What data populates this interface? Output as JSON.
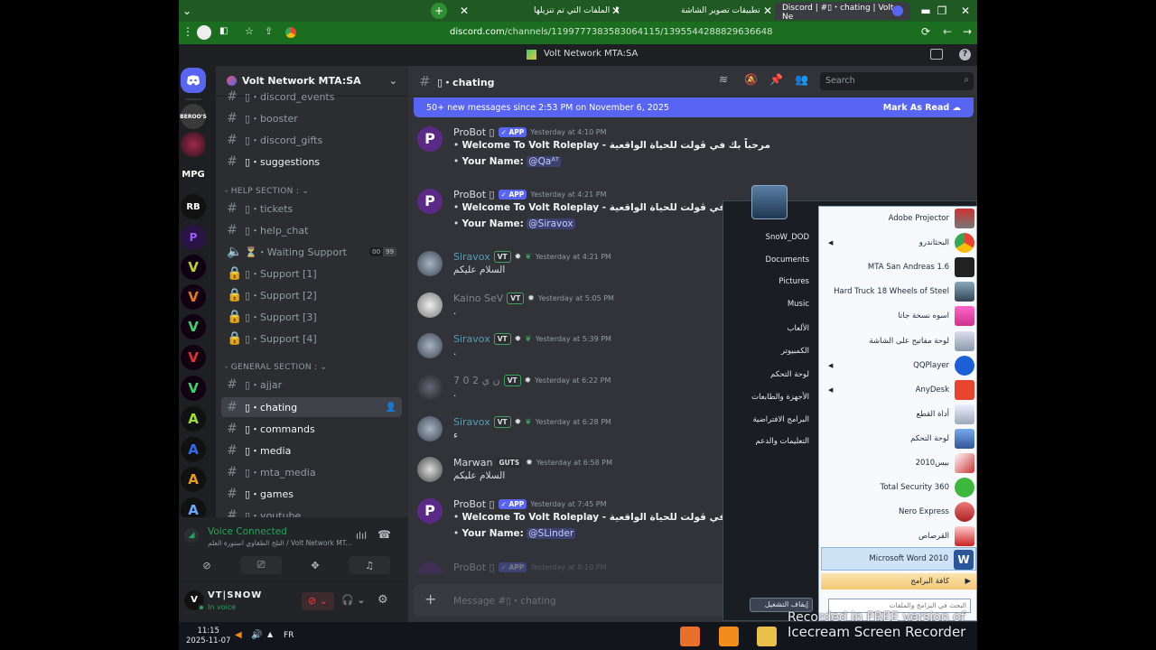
{
  "browser": {
    "tabs": [
      {
        "label": "الملفات التي تم تنزيلها"
      },
      {
        "label": "تطبيقات تصوير الشاشة"
      },
      {
        "label": "Discord | #▯・chating | Volt Ne"
      }
    ],
    "url_host": "discord.com",
    "url_path": "/channels/1199777383583064115/1395544288829636648"
  },
  "window_title": "Volt Network MTA:SA",
  "server": {
    "name": "Volt Network MTA:SA",
    "rail_labels": [
      "MPG"
    ]
  },
  "channels": [
    {
      "label": "▯・discord_events",
      "bold": false
    },
    {
      "label": "▯・booster",
      "bold": false
    },
    {
      "label": "▯・discord_gifts",
      "bold": false
    },
    {
      "label": "▯・suggestions",
      "bold": true
    },
    {
      "category": "- HELP SECTION :"
    },
    {
      "label": "▯・tickets",
      "bold": false
    },
    {
      "label": "▯・help_chat",
      "bold": false
    },
    {
      "label": "⏳・Waiting Support",
      "bold": false,
      "count_a": "00",
      "count_b": "99"
    },
    {
      "label": "▯・Support [1]",
      "bold": false
    },
    {
      "label": "▯・Support [2]",
      "bold": false
    },
    {
      "label": "▯・Support [3]",
      "bold": false
    },
    {
      "label": "▯・Support [4]",
      "bold": false
    },
    {
      "category": "- GENERAL SECTION :"
    },
    {
      "label": "▯・ajjar",
      "bold": false
    },
    {
      "label": "▯・chating",
      "bold": true
    },
    {
      "label": "▯・commands",
      "bold": true
    },
    {
      "label": "▯・media",
      "bold": true
    },
    {
      "label": "▯・mta_media",
      "bold": false
    },
    {
      "label": "▯・games",
      "bold": true
    },
    {
      "label": "▯・youtube",
      "bold": false
    }
  ],
  "voice": {
    "status": "Voice Connected",
    "channel": "التلج الطقاوي استورة العلم / Volt Network MT..."
  },
  "user": {
    "name": "VT|SNOW",
    "status": "In voice"
  },
  "chat": {
    "channel_title": "▯・chating",
    "search_placeholder": "Search",
    "new_messages": "50+ new messages since 2:53 PM on November 6, 2025",
    "mark_as_read": "Mark As Read",
    "composer_placeholder": "Message #▯・chating",
    "messages": [
      {
        "author": "ProBot ▯",
        "tag": "✓ APP",
        "time": "Yesterday at 4:10 PM",
        "lines": [
          "Welcome To Volt Roleplay - مرحباً بك في ڤولت للحياة الواقعية"
        ],
        "mention_prefix": "Your Name:",
        "mention": "@Qaᴬᵀ"
      },
      {
        "author": "ProBot ▯",
        "tag": "✓ APP",
        "time": "Yesterday at 4:21 PM",
        "lines": [
          "Welcome To Volt Roleplay - مرحباً بك في ڤولت للحياة الواقعية"
        ],
        "mention_prefix": "Your Name:",
        "mention": "@Siravox"
      },
      {
        "author": "Siravox",
        "tag": "VT",
        "time": "Yesterday at 4:21 PM",
        "text": "السلام عليكم"
      },
      {
        "author": "Kaino SeV",
        "tag": "VT",
        "time": "Yesterday at 5:05 PM",
        "text": "."
      },
      {
        "author": "Siravox",
        "tag": "VT",
        "time": "Yesterday at 5:39 PM",
        "text": "."
      },
      {
        "author": "7 0 2 ن ي",
        "tag": "VT",
        "time": "Yesterday at 6:22 PM",
        "text": "."
      },
      {
        "author": "Siravox",
        "tag": "VT",
        "time": "Yesterday at 6:28 PM",
        "text": "ء"
      },
      {
        "author": "Marwan",
        "tag": "GUTS",
        "time": "Yesterday at 6:58 PM",
        "text": "السلام عليكم"
      },
      {
        "author": "ProBot ▯",
        "tag": "✓ APP",
        "time": "Yesterday at 7:45 PM",
        "lines": [
          "Welcome To Volt Roleplay - مرحباً بك في ڤولت للحياة الواقعية"
        ],
        "mention_prefix": "Your Name:",
        "mention": "@SLinder"
      },
      {
        "author": "ProBot ▯",
        "tag": "✓ APP",
        "time": "Yesterday at 8:10 PM",
        "partial": true
      }
    ]
  },
  "startmenu": {
    "user": "SnoW_DOD",
    "right_items": [
      "SnoW_DOD",
      "Documents",
      "Pictures",
      "Music",
      "الألعاب",
      "الكمبيوتر",
      "لوحة التحكم",
      "الأجهزة والطابعات",
      "البرامج الافتراضية",
      "التعليمات والدعم"
    ],
    "programs": [
      {
        "label": "Adobe Projector",
        "arrow": false
      },
      {
        "label": "البحثاندرو",
        "arrow": true
      },
      {
        "label": "MTA San Andreas 1.6",
        "arrow": false
      },
      {
        "label": "Hard Truck 18 Wheels of Steel",
        "arrow": false
      },
      {
        "label": "اسوه نسخة جاتا",
        "arrow": false
      },
      {
        "label": "لوحة مفاتيح على الشاشة",
        "arrow": false
      },
      {
        "label": "QQPlayer",
        "arrow": true
      },
      {
        "label": "AnyDesk",
        "arrow": true
      },
      {
        "label": "أداة القطع",
        "arrow": false
      },
      {
        "label": "لوحة التحكم",
        "arrow": false
      },
      {
        "label": "2010بيس",
        "arrow": false
      },
      {
        "label": "Total Security 360",
        "arrow": false
      },
      {
        "label": "Nero Express",
        "arrow": false
      },
      {
        "label": "القرصاص",
        "arrow": false
      },
      {
        "label": "Microsoft Word 2010",
        "arrow": false,
        "selected": true
      }
    ],
    "all_programs": "كافة البرامج",
    "search_placeholder": "البحث في البرامج والملفات",
    "shutdown": "إيقاف التشغيل"
  },
  "taskbar": {
    "time": "11:15",
    "date": "2025-11-07",
    "lang": "FR"
  },
  "watermark": {
    "line1": "Recorded in FREE version of",
    "line2": "Icecream Screen Recorder"
  },
  "colors": {
    "accent": "#5865f2",
    "chrome_tab": "#205a23",
    "chrome_url": "#1b6e1f",
    "online": "#23a559"
  }
}
